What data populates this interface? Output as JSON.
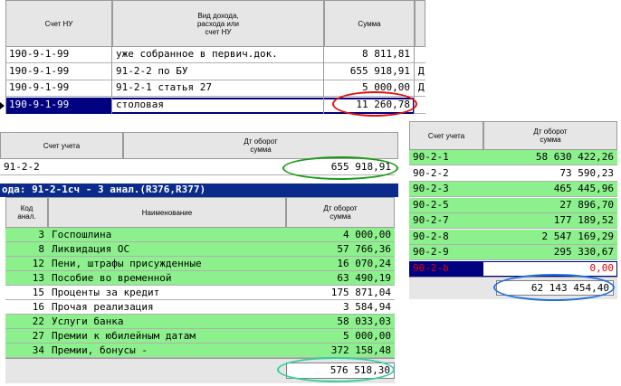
{
  "top_table": {
    "headers": [
      "Счет НУ",
      "Вид дохода,\nрасхода или\nсчет НУ",
      "Сумма"
    ],
    "rows": [
      {
        "acct": "190-9-1-99",
        "desc": "уже собранное в первич.док.",
        "sum": "8 811,81",
        "extra": ""
      },
      {
        "acct": "190-9-1-99",
        "desc": "91-2-2 по БУ",
        "sum": "655 918,91",
        "extra": "Д"
      },
      {
        "acct": "190-9-1-99",
        "desc": "91-2-1 статья 27",
        "sum": "5 000,00",
        "extra": "Д"
      },
      {
        "acct": "190-9-1-99",
        "desc": "столовая",
        "sum": "11 260,78",
        "extra": ""
      }
    ]
  },
  "mid_table": {
    "headers": [
      "Счет учета",
      "Дт оборот\nсумма"
    ],
    "row": {
      "acct": "91-2-2",
      "sum": "655 918,91"
    }
  },
  "blue_bar": "ода: 91-2-1сч - 3 анал.(R376,R377)",
  "bottom_table": {
    "headers": [
      "Код\nанал.",
      "Наименование",
      "Дт оборот\nсумма"
    ],
    "rows": [
      {
        "code": "3",
        "name": "Госпошлина",
        "sum": "4 000,00",
        "green": true
      },
      {
        "code": "8",
        "name": "Ликвидация ОС",
        "sum": "57 766,36",
        "green": true
      },
      {
        "code": "12",
        "name": "Пени, штрафы присужденные",
        "sum": "16 070,24",
        "green": true
      },
      {
        "code": "13",
        "name": "Пособие во временной",
        "sum": "63 490,19",
        "green": true
      },
      {
        "code": "15",
        "name": "Проценты за кредит",
        "sum": "175 871,04",
        "green": false
      },
      {
        "code": "16",
        "name": "Прочая реализация",
        "sum": "3 584,94",
        "green": false
      },
      {
        "code": "22",
        "name": "Услуги банка",
        "sum": "58 033,03",
        "green": true
      },
      {
        "code": "27",
        "name": "Премии к юбилейным датам",
        "sum": "5 000,00",
        "green": true
      },
      {
        "code": "34",
        "name": "Премии, бонусы -",
        "sum": "372 158,48",
        "green": true
      }
    ],
    "total": "576 518,30"
  },
  "right_table": {
    "headers": [
      "Счет учета",
      "Дт оборот\nсумма"
    ],
    "rows": [
      {
        "acct": "90-2-1",
        "sum": "58 630 422,26",
        "state": "green"
      },
      {
        "acct": "90-2-2",
        "sum": "73 590,23",
        "state": "white"
      },
      {
        "acct": "90-2-3",
        "sum": "465 445,96",
        "state": "green"
      },
      {
        "acct": "90-2-5",
        "sum": "27 896,70",
        "state": "green"
      },
      {
        "acct": "90-2-7",
        "sum": "177 189,52",
        "state": "green"
      },
      {
        "acct": "90-2-8",
        "sum": "2 547 169,29",
        "state": "green"
      },
      {
        "acct": "90-2-9",
        "sum": "295 330,67",
        "state": "green"
      },
      {
        "acct": "90-2-b",
        "sum": "0,00",
        "state": "red"
      }
    ],
    "total": "62 143 454,40"
  },
  "colors": {
    "green_row": "#8cf08c",
    "selected_row_border": "#000080",
    "red_oval": "#e01010",
    "green_oval": "#1a9a1a",
    "blue_oval": "#2070e0",
    "cyan_oval": "#30d0a0",
    "red_text": "#e00000"
  }
}
